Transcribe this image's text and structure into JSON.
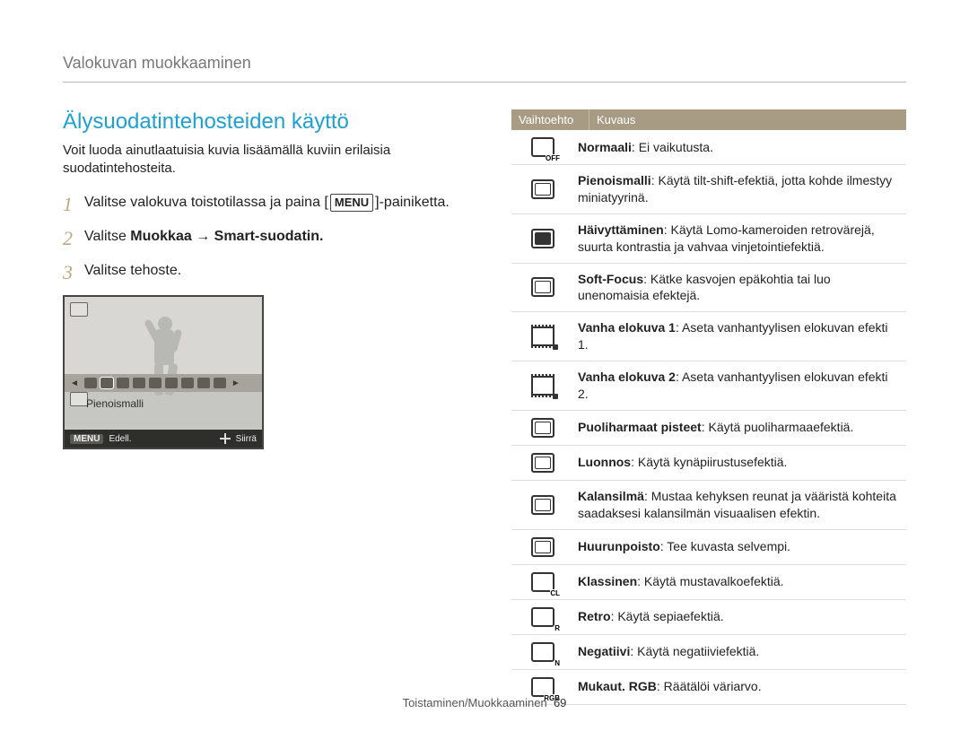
{
  "breadcrumb": "Valokuvan muokkaaminen",
  "title": "Älysuodatintehosteiden käyttö",
  "intro": "Voit luoda ainutlaatuisia kuvia lisäämällä kuviin erilaisia suodatintehosteita.",
  "steps": {
    "s1_a": "Valitse valokuva toistotilassa ja paina [",
    "s1_menu": "MENU",
    "s1_b": "]-painiketta.",
    "s2_a": "Valitse ",
    "s2_b": "Muokkaa → Smart-suodatin.",
    "s3": "Valitse tehoste."
  },
  "camera": {
    "selected_label": "Pienoismalli",
    "menu": "MENU",
    "back": "Edell.",
    "move": "Siirrä"
  },
  "table": {
    "head_option": "Vaihtoehto",
    "head_desc": "Kuvaus",
    "rows": [
      {
        "label": "Normaali",
        "desc": ": Ei vaikutusta.",
        "icon": "off"
      },
      {
        "label": "Pienoismalli",
        "desc": ": Käytä tilt-shift-efektiä, jotta kohde ilmestyy miniatyyrinä.",
        "icon": "mini"
      },
      {
        "label": "Häivyttäminen",
        "desc": ": Käytä Lomo-kameroiden retrovärejä, suurta kontrastia ja vahvaa vinjetointiefektiä.",
        "icon": "vignette"
      },
      {
        "label": "Soft-Focus",
        "desc": ": Kätke kasvojen epäkohtia tai luo unenomaisia efektejä.",
        "icon": "soft"
      },
      {
        "label": "Vanha elokuva 1",
        "desc": ": Aseta vanhantyylisen elokuvan efekti 1.",
        "icon": "film1"
      },
      {
        "label": "Vanha elokuva 2",
        "desc": ": Aseta vanhantyylisen elokuvan efekti 2.",
        "icon": "film2"
      },
      {
        "label": "Puoliharmaat pisteet",
        "desc": ": Käytä puoliharmaaefektiä.",
        "icon": "half"
      },
      {
        "label": "Luonnos",
        "desc": ": Käytä kynäpiirustusefektiä.",
        "icon": "sketch"
      },
      {
        "label": "Kalansilmä",
        "desc": ": Mustaa kehyksen reunat ja vääristä kohteita saadaksesi kalansilmän visuaalisen efektin.",
        "icon": "fisheye"
      },
      {
        "label": "Huurunpoisto",
        "desc": ": Tee kuvasta selvempi.",
        "icon": "defog"
      },
      {
        "label": "Klassinen",
        "desc": ": Käytä mustavalkoefektiä.",
        "icon": "classic"
      },
      {
        "label": "Retro",
        "desc": ": Käytä sepiaefektiä.",
        "icon": "retro"
      },
      {
        "label": "Negatiivi",
        "desc": ": Käytä negatiiviefektiä.",
        "icon": "negative"
      },
      {
        "label": "Mukaut. RGB",
        "desc": ": Räätälöi väriarvo.",
        "icon": "rgb"
      }
    ]
  },
  "footer": {
    "section": "Toistaminen/Muokkaaminen",
    "page": "69"
  }
}
